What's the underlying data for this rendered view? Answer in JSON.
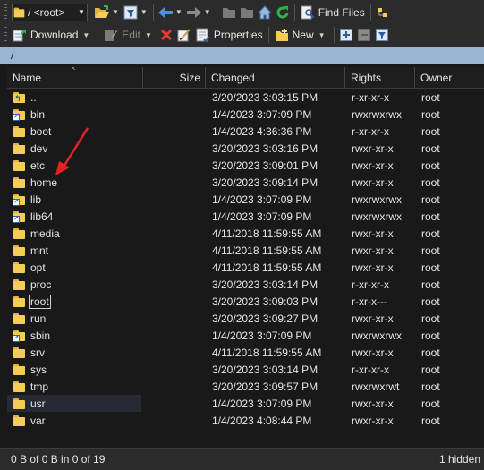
{
  "toolbar_top": {
    "path_combo_value": "/ <root>",
    "find_files_label": "Find Files",
    "icons": [
      "folder-open-icon",
      "filter-icon",
      "back-arrow-icon",
      "forward-arrow-icon",
      "parent-dir-icon",
      "root-dir-icon",
      "home-icon",
      "refresh-icon",
      "find-files-icon",
      "tree-view-icon"
    ]
  },
  "toolbar_actions": {
    "download_label": "Download",
    "edit_label": "Edit",
    "properties_label": "Properties",
    "new_label": "New",
    "icons": [
      "download-icon",
      "edit-icon",
      "delete-icon",
      "rename-icon",
      "properties-icon",
      "new-icon",
      "select-plus-icon",
      "select-minus-icon",
      "filter-icon"
    ]
  },
  "pathbar": {
    "path": "/"
  },
  "columns": {
    "name": "Name",
    "size": "Size",
    "changed": "Changed",
    "rights": "Rights",
    "owner": "Owner"
  },
  "files": [
    {
      "name": "..",
      "changed": "3/20/2023 3:03:15 PM",
      "rights": "r-xr-xr-x",
      "owner": "root",
      "kind": "updir"
    },
    {
      "name": "bin",
      "changed": "1/4/2023 3:07:09 PM",
      "rights": "rwxrwxrwx",
      "owner": "root",
      "kind": "link"
    },
    {
      "name": "boot",
      "changed": "1/4/2023 4:36:36 PM",
      "rights": "r-xr-xr-x",
      "owner": "root",
      "kind": "folder"
    },
    {
      "name": "dev",
      "changed": "3/20/2023 3:03:16 PM",
      "rights": "rwxr-xr-x",
      "owner": "root",
      "kind": "folder"
    },
    {
      "name": "etc",
      "changed": "3/20/2023 3:09:01 PM",
      "rights": "rwxr-xr-x",
      "owner": "root",
      "kind": "folder"
    },
    {
      "name": "home",
      "changed": "3/20/2023 3:09:14 PM",
      "rights": "rwxr-xr-x",
      "owner": "root",
      "kind": "folder"
    },
    {
      "name": "lib",
      "changed": "1/4/2023 3:07:09 PM",
      "rights": "rwxrwxrwx",
      "owner": "root",
      "kind": "link"
    },
    {
      "name": "lib64",
      "changed": "1/4/2023 3:07:09 PM",
      "rights": "rwxrwxrwx",
      "owner": "root",
      "kind": "link"
    },
    {
      "name": "media",
      "changed": "4/11/2018 11:59:55 AM",
      "rights": "rwxr-xr-x",
      "owner": "root",
      "kind": "folder"
    },
    {
      "name": "mnt",
      "changed": "4/11/2018 11:59:55 AM",
      "rights": "rwxr-xr-x",
      "owner": "root",
      "kind": "folder"
    },
    {
      "name": "opt",
      "changed": "4/11/2018 11:59:55 AM",
      "rights": "rwxr-xr-x",
      "owner": "root",
      "kind": "folder"
    },
    {
      "name": "proc",
      "changed": "3/20/2023 3:03:14 PM",
      "rights": "r-xr-xr-x",
      "owner": "root",
      "kind": "folder"
    },
    {
      "name": "root",
      "changed": "3/20/2023 3:09:03 PM",
      "rights": "r-xr-x---",
      "owner": "root",
      "kind": "folder",
      "focused": true
    },
    {
      "name": "run",
      "changed": "3/20/2023 3:09:27 PM",
      "rights": "rwxr-xr-x",
      "owner": "root",
      "kind": "folder"
    },
    {
      "name": "sbin",
      "changed": "1/4/2023 3:07:09 PM",
      "rights": "rwxrwxrwx",
      "owner": "root",
      "kind": "link"
    },
    {
      "name": "srv",
      "changed": "4/11/2018 11:59:55 AM",
      "rights": "rwxr-xr-x",
      "owner": "root",
      "kind": "folder"
    },
    {
      "name": "sys",
      "changed": "3/20/2023 3:03:14 PM",
      "rights": "r-xr-xr-x",
      "owner": "root",
      "kind": "folder"
    },
    {
      "name": "tmp",
      "changed": "3/20/2023 3:09:57 PM",
      "rights": "rwxrwxrwt",
      "owner": "root",
      "kind": "folder"
    },
    {
      "name": "usr",
      "changed": "1/4/2023 3:07:09 PM",
      "rights": "rwxr-xr-x",
      "owner": "root",
      "kind": "folder",
      "hover": true
    },
    {
      "name": "var",
      "changed": "1/4/2023 4:08:44 PM",
      "rights": "rwxr-xr-x",
      "owner": "root",
      "kind": "folder"
    }
  ],
  "annotation": {
    "color": "#e02424",
    "points_to": "home"
  },
  "statusbar": {
    "left": "0 B of 0 B in 0 of 19",
    "right": "1 hidden"
  },
  "colors": {
    "pathbar_bg": "#99b4d1",
    "folder": "#f6cd54",
    "background": "#191919"
  }
}
